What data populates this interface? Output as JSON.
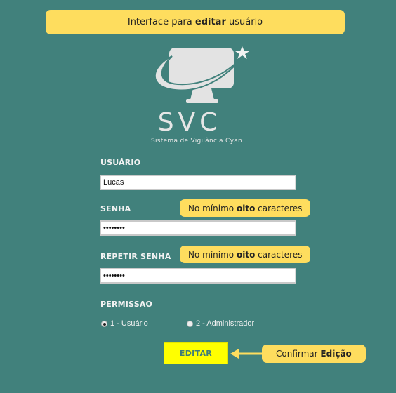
{
  "banner": {
    "prefix": "Interface para ",
    "bold": "editar",
    "suffix": " usuário"
  },
  "logo": {
    "title": "SVC",
    "subtitle": "Sistema de Vigilância Cyan"
  },
  "form": {
    "user_label": "USUÁRIO",
    "user_value": "Lucas",
    "password_label": "SENHA",
    "password_value": "••••••••",
    "repeat_label": "REPETIR SENHA",
    "repeat_value": "••••••••",
    "permission_label": "PERMISSAO",
    "options": [
      {
        "label": "1 - Usuário",
        "checked": true
      },
      {
        "label": "2 - Administrador",
        "checked": false
      }
    ],
    "submit_label": "EDITAR"
  },
  "hints": {
    "min_prefix": "No mínimo ",
    "min_bold": "oito",
    "min_suffix": " caracteres",
    "confirm_prefix": "Confirmar ",
    "confirm_bold": "Edição"
  },
  "colors": {
    "background": "#41817c",
    "callout": "#fedd5e",
    "button": "#ffff00"
  }
}
